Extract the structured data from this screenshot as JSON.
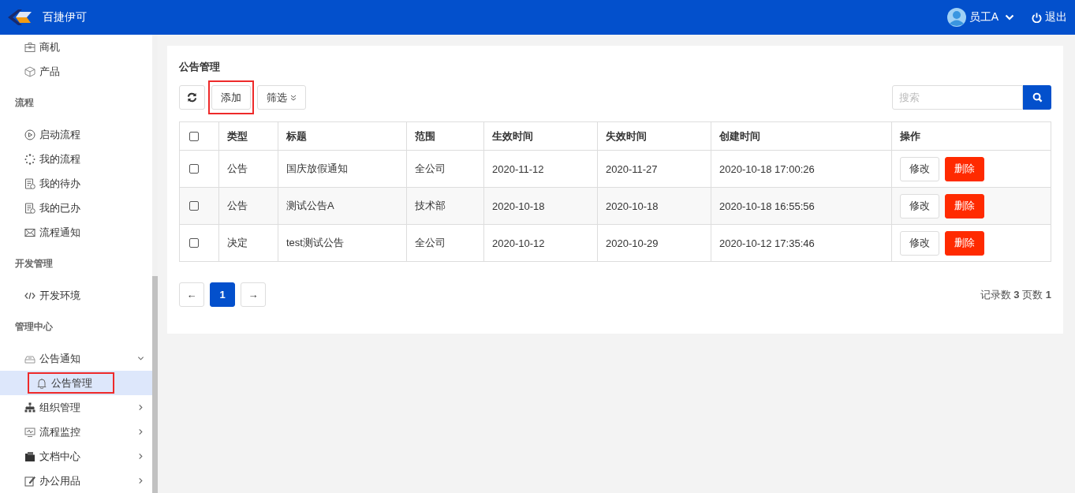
{
  "header": {
    "app_name": "百捷伊可",
    "user_name": "员工A",
    "logout": "退出"
  },
  "sidebar": [
    {
      "kind": "item",
      "label": "商机"
    },
    {
      "kind": "item",
      "label": "产品"
    },
    {
      "kind": "heading",
      "label": "流程"
    },
    {
      "kind": "item",
      "label": "启动流程"
    },
    {
      "kind": "item",
      "label": "我的流程"
    },
    {
      "kind": "item",
      "label": "我的待办"
    },
    {
      "kind": "item",
      "label": "我的已办"
    },
    {
      "kind": "item",
      "label": "流程通知"
    },
    {
      "kind": "heading",
      "label": "开发管理"
    },
    {
      "kind": "item",
      "label": "开发环境"
    },
    {
      "kind": "heading",
      "label": "管理中心"
    },
    {
      "kind": "group",
      "label": "公告通知",
      "expanded": true,
      "children": [
        {
          "label": "公告管理",
          "selected": true,
          "highlighted": true
        }
      ]
    },
    {
      "kind": "group",
      "label": "组织管理",
      "expanded": false
    },
    {
      "kind": "group",
      "label": "流程监控",
      "expanded": false
    },
    {
      "kind": "group",
      "label": "文档中心",
      "expanded": false
    },
    {
      "kind": "group",
      "label": "办公用品",
      "expanded": false
    }
  ],
  "page_title": "公告管理",
  "toolbar": {
    "add": {
      "label": "添加",
      "highlighted": true
    },
    "filter": "筛选",
    "search": {
      "placeholder": "搜索"
    }
  },
  "table": {
    "columns": [
      "类型",
      "标题",
      "范围",
      "生效时间",
      "失效时间",
      "创建时间",
      "操作"
    ],
    "rows": [
      {
        "checked": false,
        "cells": [
          "公告",
          "国庆放假通知",
          "全公司",
          "2020-11-12",
          "2020-11-27",
          "2020-10-18 17:00:26"
        ],
        "actions": [
          "修改",
          "删除"
        ]
      },
      {
        "checked": false,
        "cells": [
          "公告",
          "测试公告A",
          "技术部",
          "2020-10-18",
          "2020-10-18",
          "2020-10-18 16:55:56"
        ],
        "actions": [
          "修改",
          "删除"
        ]
      },
      {
        "checked": false,
        "cells": [
          "决定",
          "test测试公告",
          "全公司",
          "2020-10-12",
          "2020-10-29",
          "2020-10-12 17:35:46"
        ],
        "actions": [
          "修改",
          "删除"
        ]
      }
    ],
    "header_checked": false
  },
  "pagination": {
    "prev": "←",
    "next": "→",
    "pages": [
      {
        "label": "1",
        "selected": true
      }
    ],
    "summary": "记录数 **3** 页数 **1**"
  }
}
